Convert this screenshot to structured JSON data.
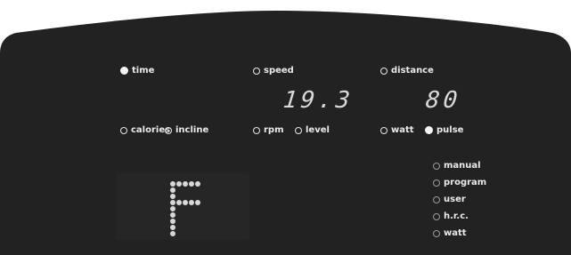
{
  "display": {
    "indicators_top": [
      {
        "key": "time",
        "label": "time",
        "active": true
      },
      {
        "key": "speed",
        "label": "speed",
        "active": false
      },
      {
        "key": "distance",
        "label": "distance",
        "active": false
      }
    ],
    "indicators_bottom": [
      {
        "key": "calories",
        "label": "calories",
        "active": false
      },
      {
        "key": "incline",
        "label": "incline",
        "active": false
      },
      {
        "key": "rpm",
        "label": "rpm",
        "active": false
      },
      {
        "key": "level",
        "label": "level",
        "active": false
      },
      {
        "key": "watt",
        "label": "watt",
        "active": false
      },
      {
        "key": "pulse",
        "label": "pulse",
        "active": true
      }
    ],
    "readout_center": "19.3",
    "readout_right": "80",
    "matrix_letter": "F",
    "programs": [
      "manual",
      "program",
      "user",
      "h.r.c.",
      "watt"
    ]
  },
  "colors": {
    "panel": "#222222",
    "matrix_bg": "#262626",
    "led": "#d8d8d8",
    "indicator": "#e8e8e8",
    "program_ring": "#a09892"
  }
}
